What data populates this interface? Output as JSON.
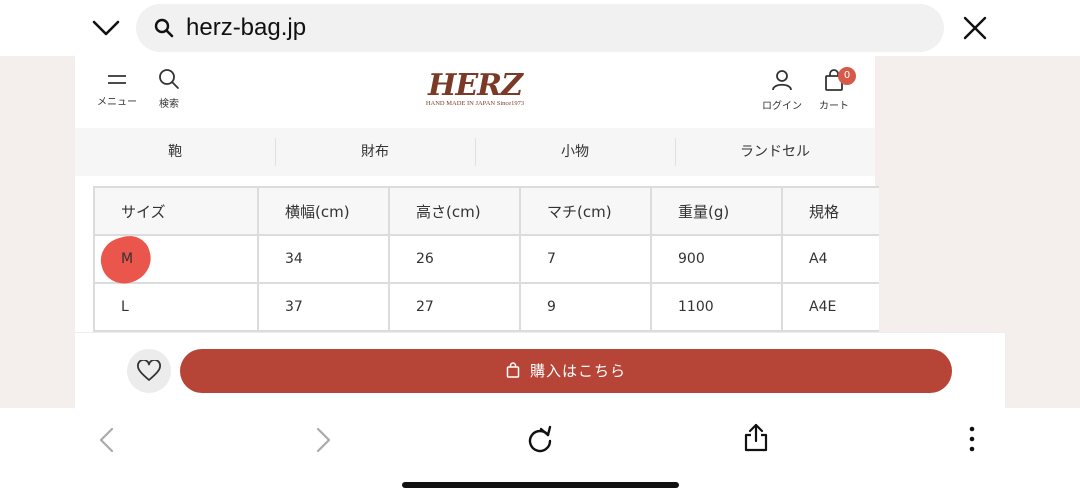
{
  "browser": {
    "url": "herz-bag.jp"
  },
  "header": {
    "menu_label": "メニュー",
    "search_label": "検索",
    "brand": "HERZ",
    "tagline": "HAND MADE IN JAPAN Since1973",
    "login_label": "ログイン",
    "cart_label": "カート",
    "cart_count": "0"
  },
  "categories": [
    {
      "label": "鞄"
    },
    {
      "label": "財布"
    },
    {
      "label": "小物"
    },
    {
      "label": "ランドセル"
    }
  ],
  "spec_table": {
    "headers": [
      "サイズ",
      "横幅(cm)",
      "高さ(cm)",
      "マチ(cm)",
      "重量(g)",
      "規格"
    ],
    "rows": [
      [
        "M",
        "34",
        "26",
        "7",
        "900",
        "A4"
      ],
      [
        "L",
        "37",
        "27",
        "9",
        "1100",
        "A4E"
      ]
    ]
  },
  "buy_bar": {
    "buy_label": "購入はこちら"
  },
  "colors": {
    "accent": "#b64437",
    "brand": "#7a3a26",
    "badge": "#d65a4a",
    "highlight_mark": "#e8463d"
  }
}
